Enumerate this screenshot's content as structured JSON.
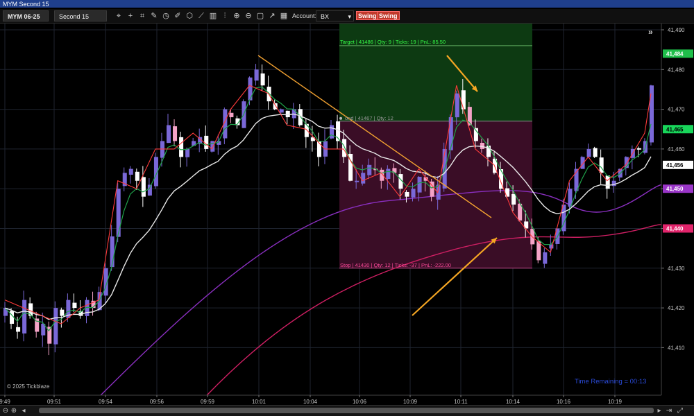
{
  "window": {
    "title": "MYM Second 15"
  },
  "toolbar": {
    "instrument": "MYM 06-25",
    "interval": "Second 15",
    "account_label": "Account:",
    "account_value": "BX",
    "strategy_buttons": [
      "Swing",
      "Swing"
    ],
    "icons": [
      "crosshair-icon",
      "cursor-icon",
      "zoom-fit-icon",
      "draw-tool-icon",
      "clock-icon",
      "pencil-icon",
      "cube-icon",
      "line-tool-icon",
      "bars-icon",
      "chart-icon",
      "zoom-in-icon",
      "zoom-out-icon",
      "square-icon",
      "trendline-icon",
      "grid-icon"
    ]
  },
  "orders": {
    "target": "Target | 41486 | Qty: 9 | Ticks: 19 | PnL: 85.50",
    "entry": "ond | 41467 | Qty: 12",
    "stop": "Stop | 41430 | Qty: 12 | Ticks: -37 | PnL: -222.00"
  },
  "price_markers": [
    {
      "text": "41,484",
      "color": "#1fbf4a",
      "price": 41484
    },
    {
      "text": "41,465",
      "color": "#18d65a",
      "price": 41465
    },
    {
      "text": "41,456",
      "color": "#ffffff",
      "price": 41456
    },
    {
      "text": "41,450",
      "color": "#9a35c8",
      "price": 41450
    },
    {
      "text": "41,440",
      "color": "#e2246b",
      "price": 41440
    }
  ],
  "footer": {
    "copyright": "© 2025 Tickblaze",
    "time_remaining": "Time Remaining = 00:13"
  },
  "colors": {
    "target_zone": "#0d3a12",
    "stop_zone": "#3a0d26",
    "bull": "#7a68d8",
    "bear": "#ffffff",
    "green_ma": "#1fa24a",
    "white_ma": "#e8e8e8",
    "purple_ma": "#8a2fc0",
    "pink_ma": "#cf1f63",
    "zigzag": "#ff3b3b",
    "trendline": "#f0a030",
    "arrow": "#f5a623",
    "grid": "#1f2430"
  },
  "chart_data": {
    "type": "candlestick",
    "instrument": "MYM 06-25",
    "interval": "Second 15",
    "ylim": [
      41400,
      41500
    ],
    "y_ticks": [
      41410,
      41420,
      41430,
      41440,
      41450,
      41460,
      41470,
      41480,
      41490
    ],
    "y_tick_labels": [
      "41,410",
      "41,420",
      "41,430",
      "41,440",
      "41,450",
      "41,460",
      "41,470",
      "41,480",
      "41,490"
    ],
    "x_tick_labels": [
      "9:49",
      "09:51",
      "09:54",
      "09:56",
      "09:59",
      "10:01",
      "10:04",
      "10:06",
      "10:09",
      "10:11",
      "10:14",
      "10:16",
      "10:19"
    ],
    "target_price": 41486,
    "entry_price": 41467,
    "stop_price": 41430,
    "trendline": {
      "start": [
        41484
      ],
      "end": [
        41451
      ]
    },
    "close_path": [
      41420,
      41416,
      41414,
      41422,
      41418,
      41414,
      41416,
      41411,
      41420,
      41418,
      41422,
      41420,
      41418,
      41422,
      41420,
      41424,
      41430,
      41438,
      41450,
      41454,
      41455,
      41452,
      41448,
      41451,
      41458,
      41462,
      41466,
      41462,
      41458,
      41460,
      41462,
      41463,
      41460,
      41462,
      41462,
      41470,
      41468,
      41466,
      41472,
      41478,
      41480,
      41476,
      41472,
      41470,
      41470,
      41468,
      41470,
      41466,
      41463,
      41462,
      41458,
      41462,
      41466,
      41462,
      41458,
      41452,
      41452,
      41454,
      41456,
      41455,
      41452,
      41455,
      41454,
      41450,
      41448,
      41450,
      41453,
      41452,
      41448,
      41451,
      41460,
      41468,
      41474,
      41470,
      41466,
      41462,
      41460,
      41458,
      41454,
      41450,
      41448,
      41446,
      41442,
      41440,
      41436,
      41432,
      41434,
      41436,
      41440,
      41446,
      41450,
      41455,
      41458,
      41460,
      41458,
      41454,
      41450,
      41452,
      41455,
      41458,
      41460,
      41460,
      41462,
      41476
    ]
  }
}
